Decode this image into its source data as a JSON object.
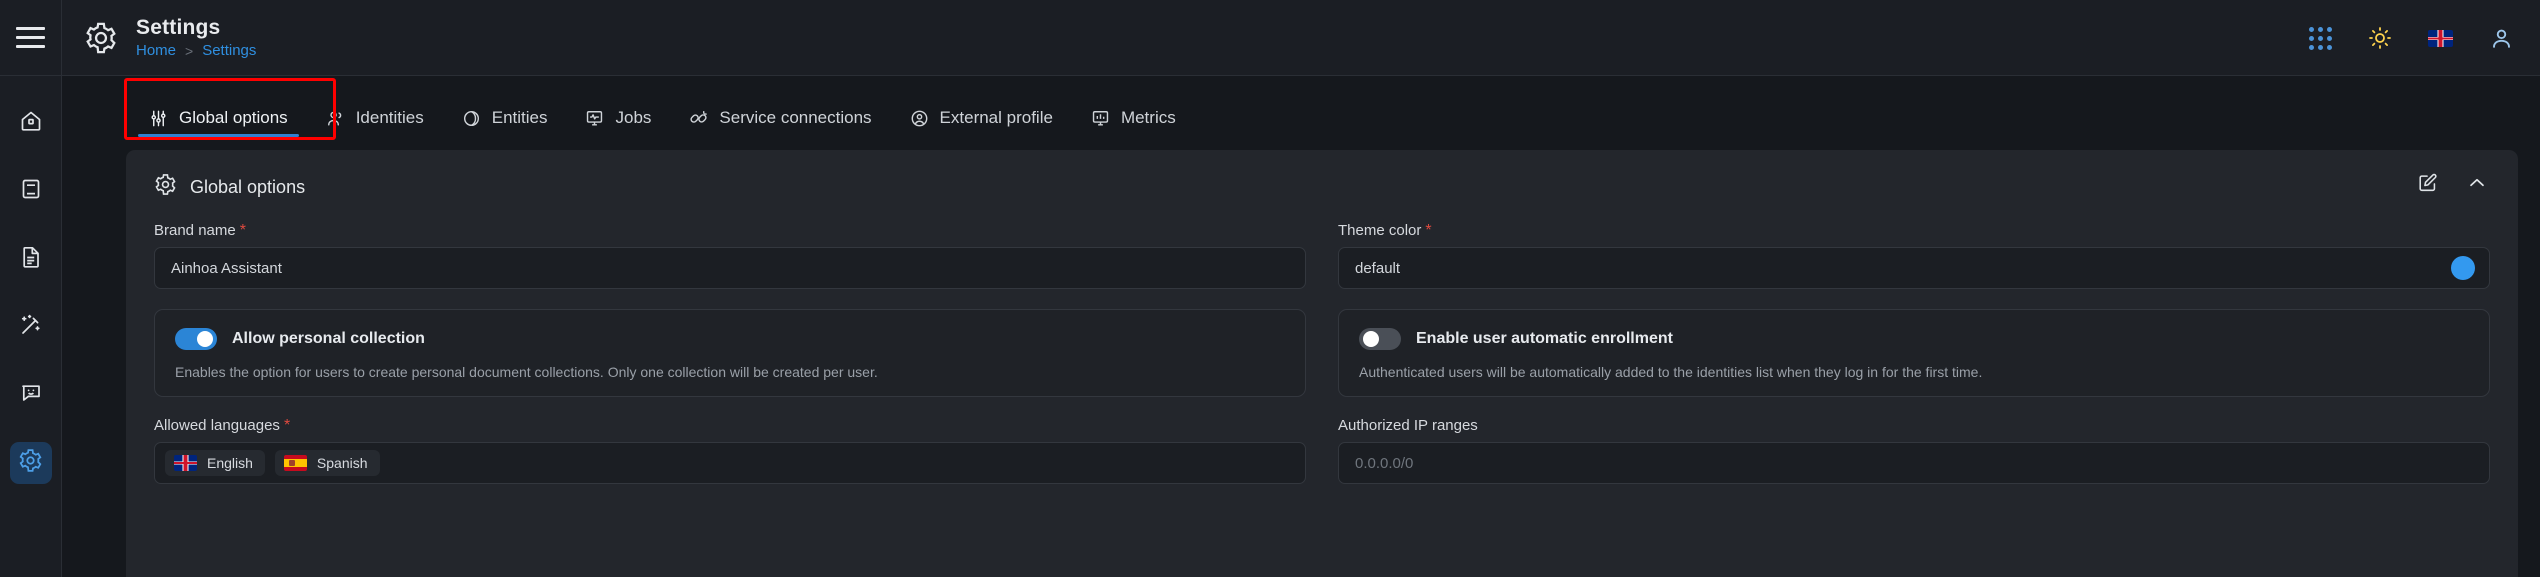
{
  "header": {
    "title": "Settings",
    "breadcrumb": {
      "home": "Home",
      "separator": ">",
      "current": "Settings"
    },
    "menu_icon": "hamburger-icon",
    "title_icon": "gear-icon",
    "right_icons": [
      "apps-grid-icon",
      "sun-icon",
      "flag-uk-icon",
      "user-avatar-icon"
    ]
  },
  "sidebar": {
    "items": [
      {
        "icon": "home-icon",
        "active": false
      },
      {
        "icon": "book-icon",
        "active": false
      },
      {
        "icon": "document-icon",
        "active": false
      },
      {
        "icon": "magic-wand-icon",
        "active": false
      },
      {
        "icon": "chat-icon",
        "active": false
      },
      {
        "icon": "gear-icon",
        "active": true
      }
    ]
  },
  "tabs": [
    {
      "label": "Global options",
      "icon": "sliders-icon",
      "active": true
    },
    {
      "label": "Identities",
      "icon": "people-icon",
      "active": false
    },
    {
      "label": "Entities",
      "icon": "tag-icon",
      "active": false
    },
    {
      "label": "Jobs",
      "icon": "monitor-pulse-icon",
      "active": false
    },
    {
      "label": "Service connections",
      "icon": "plug-icon",
      "active": false
    },
    {
      "label": "External profile",
      "icon": "user-circle-icon",
      "active": false
    },
    {
      "label": "Metrics",
      "icon": "monitor-chart-icon",
      "active": false
    }
  ],
  "card": {
    "title": "Global options",
    "title_icon": "gear-icon",
    "actions": [
      {
        "name": "edit-button",
        "icon": "edit-pencil-icon"
      },
      {
        "name": "collapse-button",
        "icon": "chevron-up-icon"
      }
    ],
    "fields": {
      "brand_name": {
        "label": "Brand name",
        "required": true,
        "value": "Ainhoa Assistant"
      },
      "theme_color": {
        "label": "Theme color",
        "required": true,
        "value": "default",
        "swatch_hex": "#3399ef"
      },
      "allowed_languages": {
        "label": "Allowed languages",
        "required": true,
        "chips": [
          {
            "label": "English",
            "flag": "flag-uk-icon"
          },
          {
            "label": "Spanish",
            "flag": "flag-es-icon"
          }
        ]
      },
      "authorized_ip_ranges": {
        "label": "Authorized IP ranges",
        "required": false,
        "value": "",
        "placeholder": "0.0.0.0/0"
      }
    },
    "toggles": [
      {
        "label": "Allow personal collection",
        "state": "on",
        "description": "Enables the option for users to create personal document collections. Only one collection will be created per user."
      },
      {
        "label": "Enable user automatic enrollment",
        "state": "off",
        "description": "Authenticated users will be automatically added to the identities list when they log in for the first time."
      }
    ]
  },
  "annotation": {
    "color": "#ff0000",
    "target": "Global options"
  },
  "colors": {
    "page_bg": "#15181d",
    "panel_bg": "#1b1e24",
    "card_bg": "#23262c",
    "accent_blue": "#2f8fe0",
    "required_red": "#e04a3f",
    "toggle_on": "#2b85d6"
  }
}
